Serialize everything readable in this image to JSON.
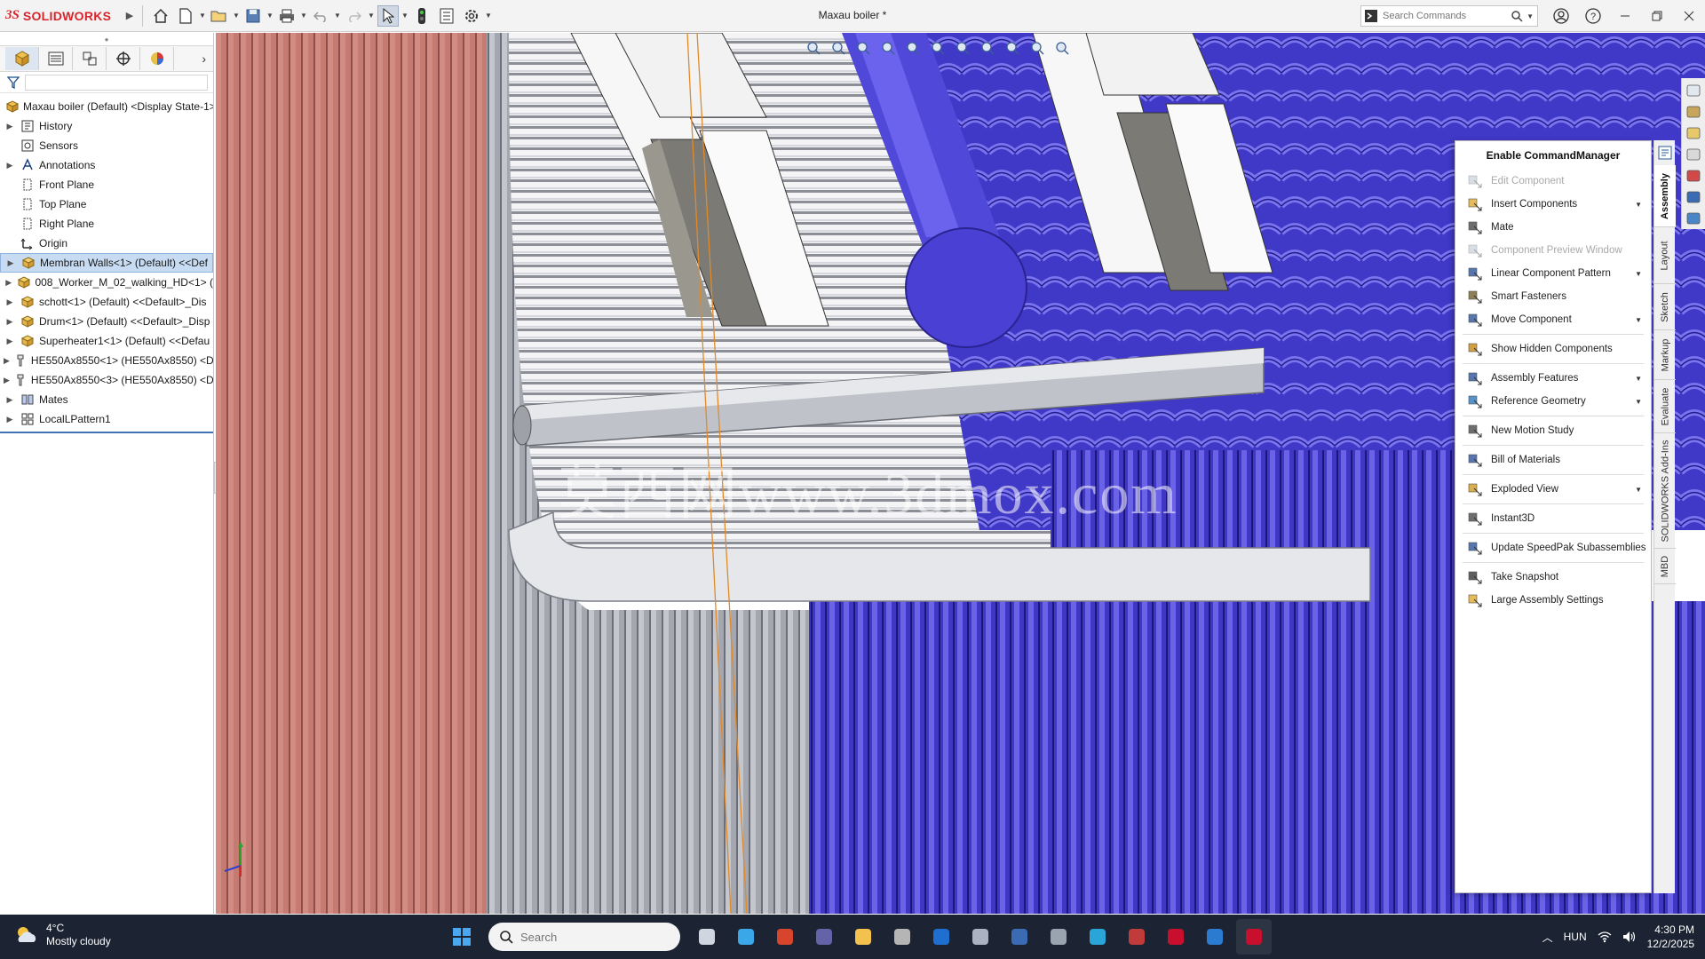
{
  "app": {
    "logo_ds": "3S",
    "logo_text": "SOLIDWORKS",
    "document_title": "Maxau boiler *"
  },
  "toolbar": {
    "icons": [
      "home-icon",
      "new-document-icon",
      "open-icon",
      "save-icon",
      "print-icon",
      "undo-icon",
      "redo-icon",
      "select-icon",
      "traffic-light-icon",
      "file-properties-icon",
      "options-icon"
    ],
    "search_placeholder": "Search Commands"
  },
  "left_panel": {
    "tabs": [
      "featuremanager-tab",
      "propertymanager-tab",
      "configurationmanager-tab",
      "dimxpert-tab",
      "appearance-tab"
    ],
    "tree": [
      {
        "label": "Maxau boiler (Default) <Display State-1>",
        "icon": "assembly-icon",
        "expander": "",
        "root": true
      },
      {
        "label": "History",
        "icon": "history-icon",
        "expander": "▶"
      },
      {
        "label": "Sensors",
        "icon": "sensors-icon",
        "expander": ""
      },
      {
        "label": "Annotations",
        "icon": "annotations-icon",
        "expander": "▶"
      },
      {
        "label": "Front Plane",
        "icon": "plane-icon",
        "expander": ""
      },
      {
        "label": "Top Plane",
        "icon": "plane-icon",
        "expander": ""
      },
      {
        "label": "Right Plane",
        "icon": "plane-icon",
        "expander": ""
      },
      {
        "label": "Origin",
        "icon": "origin-icon",
        "expander": ""
      },
      {
        "label": "Membran Walls<1> (Default) <<Def",
        "icon": "subassembly-icon",
        "expander": "▶",
        "selected": true
      },
      {
        "label": "008_Worker_M_02_walking_HD<1> (",
        "icon": "subassembly-icon",
        "expander": "▶"
      },
      {
        "label": "schott<1> (Default) <<Default>_Dis",
        "icon": "subassembly-icon",
        "expander": "▶"
      },
      {
        "label": "Drum<1> (Default) <<Default>_Disp",
        "icon": "subassembly-icon",
        "expander": "▶"
      },
      {
        "label": "Superheater1<1> (Default) <<Defau",
        "icon": "subassembly-icon",
        "expander": "▶"
      },
      {
        "label": "HE550Ax8550<1> (HE550Ax8550) <D",
        "icon": "part-icon",
        "expander": "▶"
      },
      {
        "label": "HE550Ax8550<3> (HE550Ax8550) <D",
        "icon": "part-icon",
        "expander": "▶"
      },
      {
        "label": "Mates",
        "icon": "mates-icon",
        "expander": "▶"
      },
      {
        "label": "LocalLPattern1",
        "icon": "pattern-icon",
        "expander": "▶"
      }
    ]
  },
  "viewport": {
    "headsup_icons": [
      "zoom-to-fit-icon",
      "zoom-to-area-icon",
      "previous-view-icon",
      "section-view-icon",
      "dynamic-annotation-icon",
      "view-orientation-icon",
      "display-style-icon",
      "hide-show-icon",
      "edit-appearance-icon",
      "scene-icon",
      "view-settings-icon"
    ],
    "watermark": "莫西网www.3dmox.com"
  },
  "command_manager": {
    "title": "Enable CommandManager",
    "groups": [
      [
        {
          "label": "Edit Component",
          "icon": "edit-component-icon",
          "disabled": true,
          "dropdown": false
        },
        {
          "label": "Insert Components",
          "icon": "insert-components-icon",
          "disabled": false,
          "dropdown": true
        },
        {
          "label": "Mate",
          "icon": "mate-icon",
          "disabled": false,
          "dropdown": false
        },
        {
          "label": "Component Preview Window",
          "icon": "preview-window-icon",
          "disabled": true,
          "dropdown": false
        },
        {
          "label": "Linear Component Pattern",
          "icon": "linear-pattern-icon",
          "disabled": false,
          "dropdown": true
        },
        {
          "label": "Smart Fasteners",
          "icon": "smart-fasteners-icon",
          "disabled": false,
          "dropdown": false
        },
        {
          "label": "Move Component",
          "icon": "move-component-icon",
          "disabled": false,
          "dropdown": true
        }
      ],
      [
        {
          "label": "Show Hidden Components",
          "icon": "show-hidden-icon",
          "disabled": false,
          "dropdown": false
        }
      ],
      [
        {
          "label": "Assembly Features",
          "icon": "assembly-features-icon",
          "disabled": false,
          "dropdown": true
        },
        {
          "label": "Reference Geometry",
          "icon": "reference-geometry-icon",
          "disabled": false,
          "dropdown": true
        }
      ],
      [
        {
          "label": "New Motion Study",
          "icon": "motion-study-icon",
          "disabled": false,
          "dropdown": false
        }
      ],
      [
        {
          "label": "Bill of Materials",
          "icon": "bom-icon",
          "disabled": false,
          "dropdown": false
        }
      ],
      [
        {
          "label": "Exploded View",
          "icon": "exploded-view-icon",
          "disabled": false,
          "dropdown": true
        }
      ],
      [
        {
          "label": "Instant3D",
          "icon": "instant3d-icon",
          "disabled": false,
          "dropdown": false
        }
      ],
      [
        {
          "label": "Update SpeedPak Subassemblies",
          "icon": "speedpak-icon",
          "disabled": false,
          "dropdown": false
        }
      ],
      [
        {
          "label": "Take Snapshot",
          "icon": "snapshot-icon",
          "disabled": false,
          "dropdown": false
        },
        {
          "label": "Large Assembly Settings",
          "icon": "large-assembly-icon",
          "disabled": false,
          "dropdown": false
        }
      ]
    ],
    "tabs": [
      {
        "label": "Assembly",
        "active": true
      },
      {
        "label": "Layout",
        "active": false
      },
      {
        "label": "Sketch",
        "active": false
      },
      {
        "label": "Markup",
        "active": false
      },
      {
        "label": "Evaluate",
        "active": false
      },
      {
        "label": "SOLIDWORKS Add-Ins",
        "active": false
      },
      {
        "label": "MBD",
        "active": false
      }
    ]
  },
  "taskpane_icons": [
    "resources-icon",
    "design-library-icon",
    "file-explorer-icon",
    "view-palette-icon",
    "appearances-icon",
    "custom-properties-icon",
    "forum-icon"
  ],
  "taskbar": {
    "temperature": "4°C",
    "weather": "Mostly cloudy",
    "search_placeholder": "Search",
    "apps": [
      "task-view-icon",
      "widgets-icon",
      "office-icon",
      "teams-icon",
      "file-explorer-icon",
      "notepad-icon",
      "outlook-icon",
      "keyboard-icon",
      "save-app-icon",
      "chip-icon",
      "edge-icon",
      "flag-icon",
      "spider-icon",
      "store-icon",
      "solidworks-app-icon"
    ],
    "language": "HUN",
    "time": "4:30 PM",
    "date": "12/2/2025"
  },
  "colors": {
    "red_wall": "#c97a72",
    "blue_tubes": "#4a42c8",
    "grey_tubes": "#a7a9b2",
    "accent": "#d8252b"
  }
}
